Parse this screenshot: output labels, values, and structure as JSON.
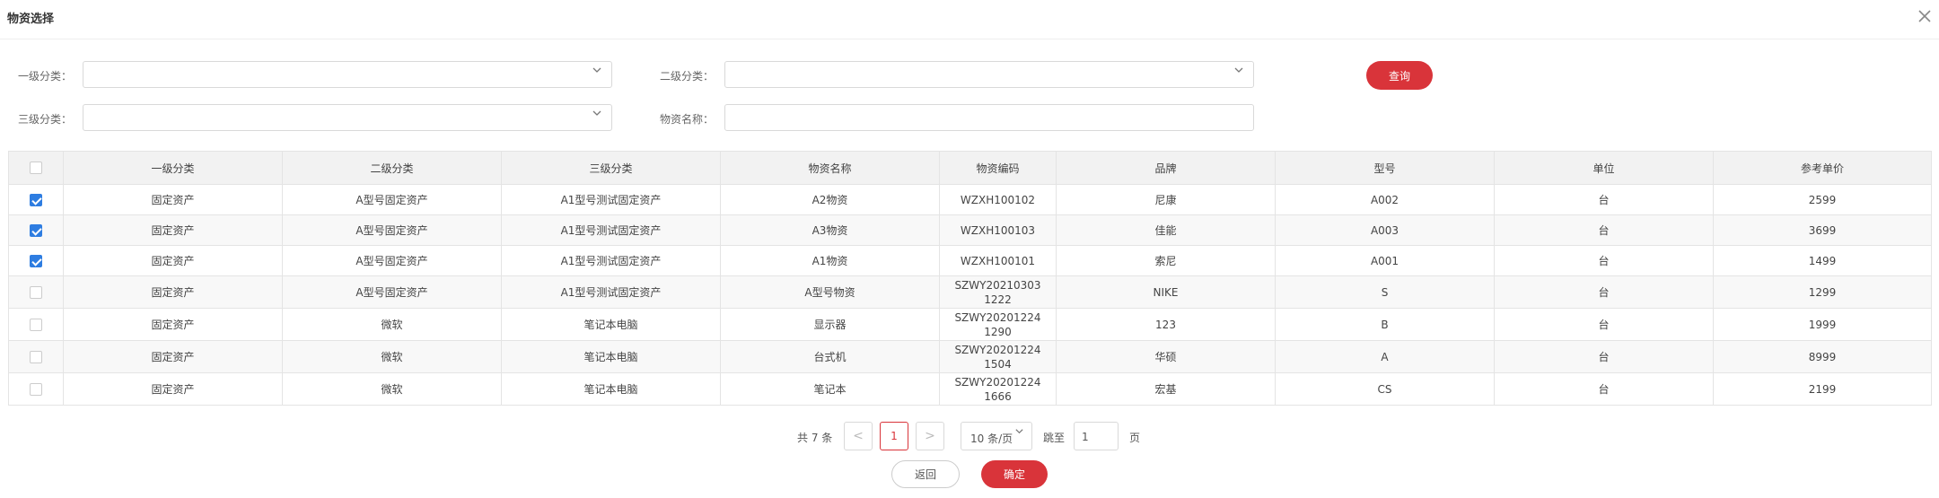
{
  "dialog": {
    "title": "物资选择"
  },
  "filters": {
    "level1_label": "一级分类：",
    "level2_label": "二级分类：",
    "level3_label": "三级分类：",
    "name_label": "物资名称：",
    "level1_value": "",
    "level2_value": "",
    "level3_value": "",
    "name_value": "",
    "query_label": "查询"
  },
  "table": {
    "columns": [
      "一级分类",
      "二级分类",
      "三级分类",
      "物资名称",
      "物资编码",
      "品牌",
      "型号",
      "单位",
      "参考单价"
    ],
    "rows": [
      {
        "checked": true,
        "cells": [
          "固定资产",
          "A型号固定资产",
          "A1型号测试固定资产",
          "A2物资",
          "WZXH100102",
          "尼康",
          "A002",
          "台",
          "2599"
        ]
      },
      {
        "checked": true,
        "cells": [
          "固定资产",
          "A型号固定资产",
          "A1型号测试固定资产",
          "A3物资",
          "WZXH100103",
          "佳能",
          "A003",
          "台",
          "3699"
        ]
      },
      {
        "checked": true,
        "cells": [
          "固定资产",
          "A型号固定资产",
          "A1型号测试固定资产",
          "A1物资",
          "WZXH100101",
          "索尼",
          "A001",
          "台",
          "1499"
        ]
      },
      {
        "checked": false,
        "cells": [
          "固定资产",
          "A型号固定资产",
          "A1型号测试固定资产",
          "A型号物资",
          "SZWY20210303\n1222",
          "NIKE",
          "S",
          "台",
          "1299"
        ]
      },
      {
        "checked": false,
        "cells": [
          "固定资产",
          "微软",
          "笔记本电脑",
          "显示器",
          "SZWY20201224\n1290",
          "123",
          "B",
          "台",
          "1999"
        ]
      },
      {
        "checked": false,
        "cells": [
          "固定资产",
          "微软",
          "笔记本电脑",
          "台式机",
          "SZWY20201224\n1504",
          "华硕",
          "A",
          "台",
          "8999"
        ]
      },
      {
        "checked": false,
        "cells": [
          "固定资产",
          "微软",
          "笔记本电脑",
          "笔记本",
          "SZWY20201224\n1666",
          "宏基",
          "CS",
          "台",
          "2199"
        ]
      }
    ]
  },
  "pagination": {
    "total_text": "共 7 条",
    "prev": "<",
    "current_page": "1",
    "next": ">",
    "page_size": "10 条/页",
    "jump_label": "跳至",
    "jump_value": "1",
    "page_suffix": "页"
  },
  "footer": {
    "back_label": "返回",
    "ok_label": "确定"
  },
  "colors": {
    "accent": "#d9343a",
    "checkbox": "#2e7de1"
  },
  "icons": {
    "close": "close-icon",
    "dropdown": "chevron-down-icon"
  }
}
